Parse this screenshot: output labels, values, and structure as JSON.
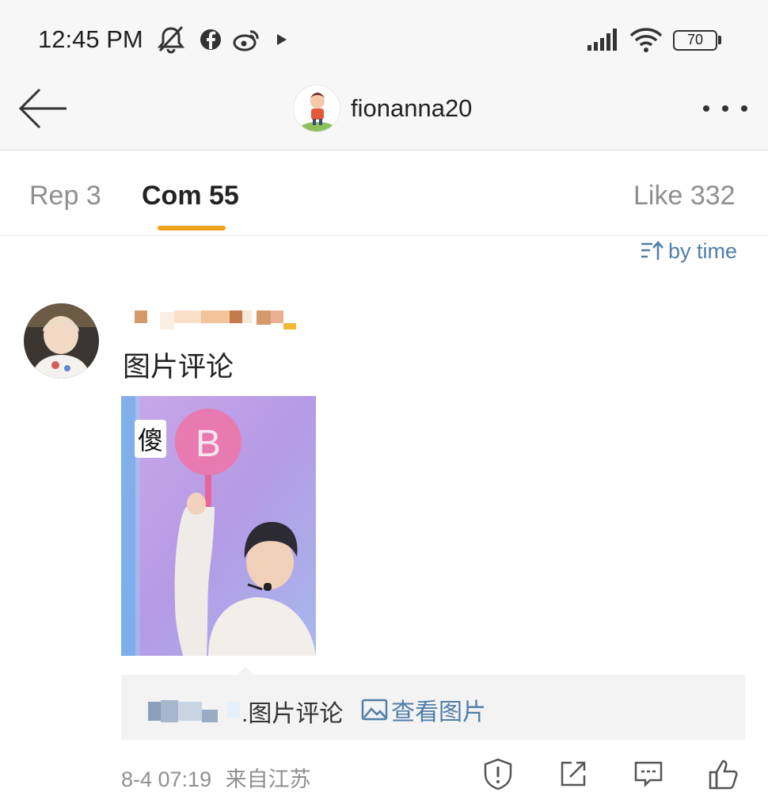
{
  "status_bar": {
    "time": "12:45 PM",
    "battery": "70",
    "icons": [
      "mute-icon",
      "facebook-icon",
      "weibo-icon",
      "play-store-icon",
      "signal-icon",
      "wifi-icon",
      "battery-icon"
    ]
  },
  "header": {
    "username": "fionanna20",
    "back_icon": "arrow-left-icon",
    "more_icon": "more-dots-icon"
  },
  "tabs": [
    {
      "label": "Rep 3",
      "active": false
    },
    {
      "label": "Com 55",
      "active": true
    },
    {
      "label": "Like 332",
      "active": false
    }
  ],
  "accent_color": "#f0a21c",
  "link_color": "#4f7ea8",
  "sort": {
    "label": "by time",
    "icon": "sort-icon"
  },
  "comment": {
    "text": "图片评论",
    "image_overlay_char": "傻",
    "image_sign_letter": "B",
    "reply": {
      "text": ".图片评论",
      "link_label": "查看图片"
    },
    "timestamp": "8-4 07:19",
    "source": "来自江苏",
    "actions": [
      "report-icon",
      "share-icon",
      "reply-icon",
      "like-icon"
    ]
  }
}
